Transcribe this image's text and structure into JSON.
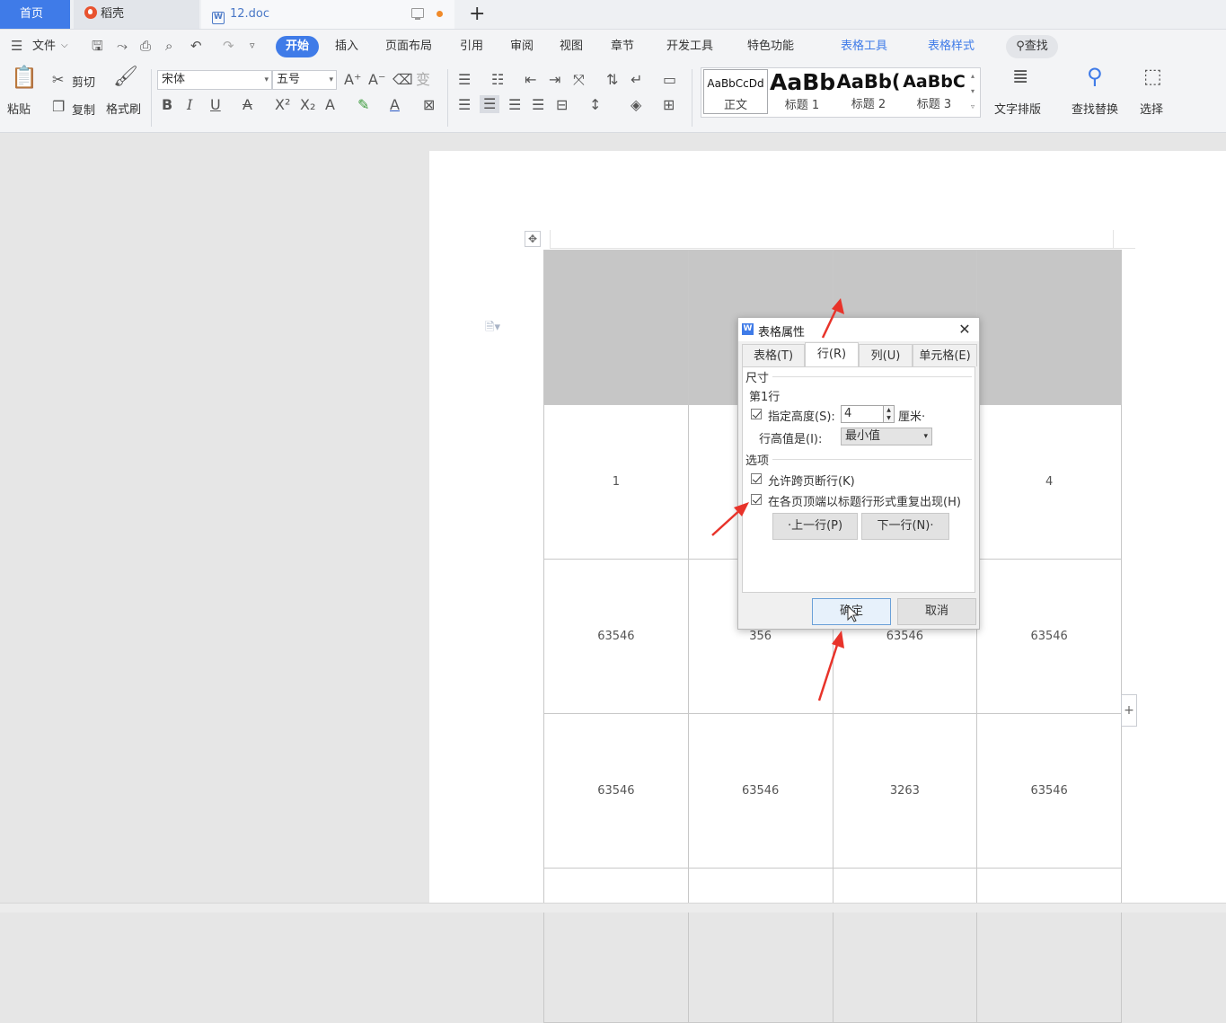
{
  "tabs": {
    "home": "首页",
    "docer": "稻壳",
    "doc": "12.doc",
    "add": "+"
  },
  "menu": {
    "file": "文件",
    "items": [
      "开始",
      "插入",
      "页面布局",
      "引用",
      "审阅",
      "视图",
      "章节",
      "开发工具",
      "特色功能"
    ],
    "context": [
      "表格工具",
      "表格样式"
    ],
    "search": "查找"
  },
  "ribbon": {
    "paste": "粘贴",
    "cut": "剪切",
    "copy": "复制",
    "format_painter": "格式刷",
    "font_name": "宋体",
    "font_size": "五号",
    "styles": [
      {
        "sample": "AaBbCcDd",
        "name": "正文"
      },
      {
        "sample": "AaBb",
        "name": "标题 1"
      },
      {
        "sample": "AaBb(",
        "name": "标题 2"
      },
      {
        "sample": "AaBbC",
        "name": "标题 3"
      }
    ],
    "text_layout": "文字排版",
    "find_replace": "查找替换",
    "select": "选择"
  },
  "table": {
    "rows": [
      [
        "1",
        "",
        "",
        "4"
      ],
      [
        "63546",
        "356",
        "63546",
        "63546"
      ],
      [
        "63546",
        "63546",
        "3263",
        "63546"
      ]
    ]
  },
  "dialog": {
    "title": "表格属性",
    "tabs": [
      "表格(T)",
      "行(R)",
      "列(U)",
      "单元格(E)"
    ],
    "active_tab": "行(R)",
    "size_group": "尺寸",
    "row_label": "第1行",
    "specify_height": "指定高度(S):",
    "height_value": "4",
    "unit": "厘米·",
    "row_height_is": "行高值是(I):",
    "row_height_mode": "最小值",
    "options_group": "选项",
    "allow_break": "允许跨页断行(K)",
    "repeat_header": "在各页顶端以标题行形式重复出现(H)",
    "prev_row": "·上一行(P)",
    "next_row": "下一行(N)·",
    "ok": "确定",
    "cancel": "取消"
  },
  "colors": {
    "accent": "#3f7be8",
    "annotation_arrow": "#e8332a"
  }
}
